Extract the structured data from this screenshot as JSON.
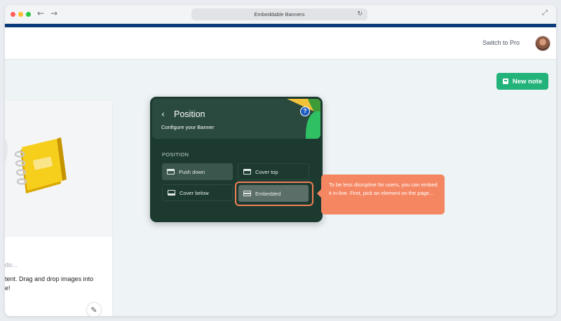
{
  "browser": {
    "url_title": "Embeddable Banners",
    "traffic_lights": [
      "#ff5f57",
      "#febc2e",
      "#28c840"
    ]
  },
  "topnav": {
    "switch_label": "Switch to Pro"
  },
  "main": {
    "new_note_label": "New note",
    "note_card": {
      "todo_text": "do...",
      "description": "tent. Drag and drop images into\ne!"
    }
  },
  "panel": {
    "title": "Position",
    "subtitle": "Configure your Banner",
    "section_label": "POSITION",
    "options": [
      {
        "label": "Push down",
        "selected": false
      },
      {
        "label": "Cover top",
        "selected": false
      },
      {
        "label": "Cover below",
        "selected": false
      },
      {
        "label": "Embedded",
        "selected": true
      }
    ],
    "help_glyph": "?"
  },
  "tooltip": {
    "text": "To be less disruptive for users, you can embed it in-line. First, pick an element on the page..."
  },
  "colors": {
    "accent_bar": "#0b3a7a",
    "new_note_bg": "#22b37a",
    "panel_bg": "#1c3a30",
    "tooltip_bg": "#f58662",
    "highlight": "#f08055"
  }
}
